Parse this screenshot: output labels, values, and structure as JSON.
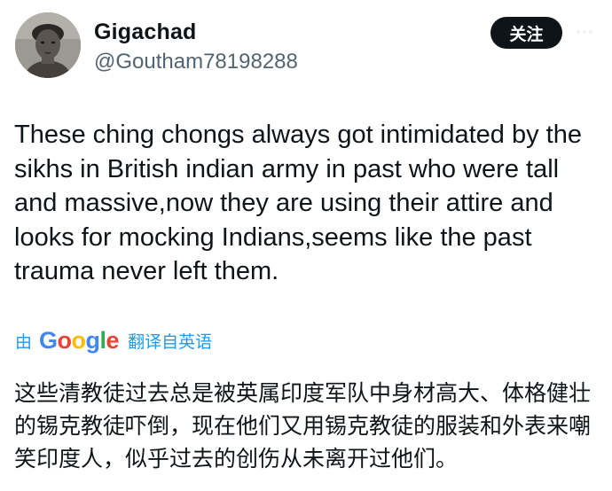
{
  "author": {
    "display_name": "Gigachad",
    "handle": "@Goutham78198288"
  },
  "actions": {
    "follow_label": "关注"
  },
  "tweet": {
    "text": "These ching chongs always got intimidated by the\nsikhs in British indian army in past who were tall\nand massive,now they are using their attire and\nlooks for mocking Indians,seems like the past\ntrauma never left them."
  },
  "translation": {
    "by_label": "由",
    "provider": "Google",
    "link_label": "翻译自英语",
    "text": "这些清教徒过去总是被英属印度军队中身材高大、体格健壮的锡克教徒吓倒，现在他们又用锡克教徒的服装和外表来嘲笑印度人，似乎过去的创伤从未离开过他们。"
  },
  "colors": {
    "accent": "#1d9bf0",
    "text_primary": "#0f1419",
    "text_secondary": "#536471",
    "follow_bg": "#0f1419"
  },
  "icons": {
    "avatar": "profile-photo",
    "more": "more-dots-icon"
  }
}
